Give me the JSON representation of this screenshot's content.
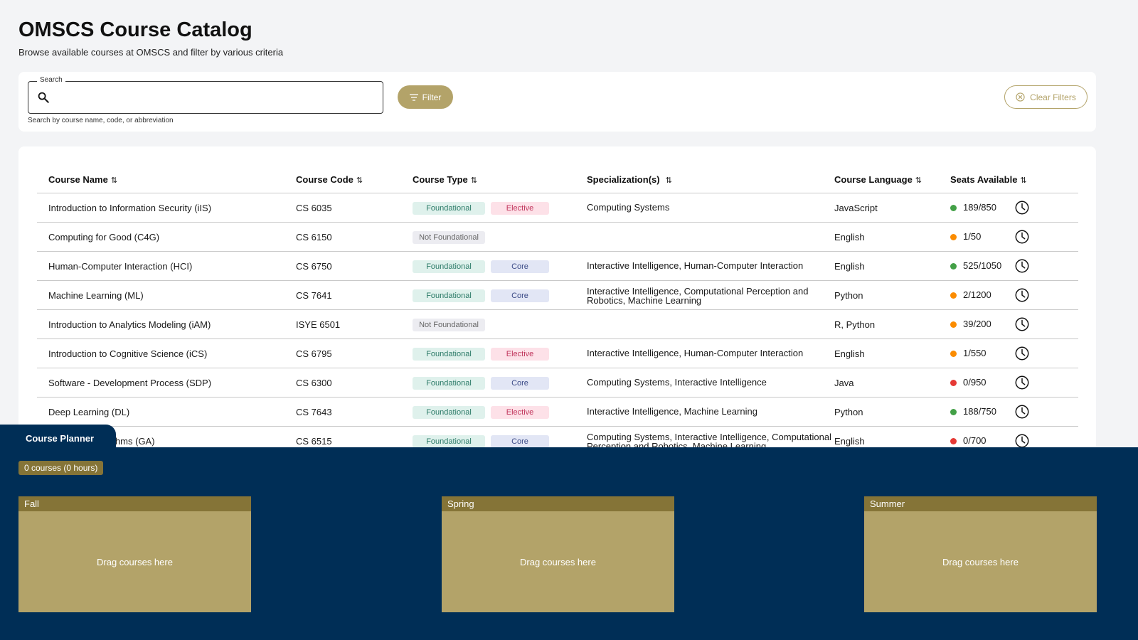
{
  "header": {
    "title": "OMSCS Course Catalog",
    "subtitle": "Browse available courses at OMSCS and filter by various criteria"
  },
  "search": {
    "legend": "Search",
    "value": "",
    "helper": "Search by course name, code, or abbreviation"
  },
  "filters": {
    "filter_label": "Filter",
    "clear_label": "Clear Filters"
  },
  "table": {
    "columns": [
      "Course Name",
      "Course Code",
      "Course Type",
      "Specialization(s)",
      "Course Language",
      "Seats Available"
    ],
    "rows": [
      {
        "name": "Introduction to Information Security (iIS)",
        "code": "CS 6035",
        "type": "Foundational",
        "category": "Elective",
        "specializations": "Computing Systems",
        "language": "JavaScript",
        "seats": "189/850",
        "status": "green"
      },
      {
        "name": "Computing for Good (C4G)",
        "code": "CS 6150",
        "type": "Not Foundational",
        "category": "",
        "specializations": "",
        "language": "English",
        "seats": "1/50",
        "status": "orange"
      },
      {
        "name": "Human-Computer Interaction (HCI)",
        "code": "CS 6750",
        "type": "Foundational",
        "category": "Core",
        "specializations": "Interactive Intelligence, Human-Computer Interaction",
        "language": "English",
        "seats": "525/1050",
        "status": "green"
      },
      {
        "name": "Machine Learning (ML)",
        "code": "CS 7641",
        "type": "Foundational",
        "category": "Core",
        "specializations": "Interactive Intelligence, Computational Perception and Robotics, Machine Learning",
        "language": "Python",
        "seats": "2/1200",
        "status": "orange"
      },
      {
        "name": "Introduction to Analytics Modeling (iAM)",
        "code": "ISYE 6501",
        "type": "Not Foundational",
        "category": "",
        "specializations": "",
        "language": "R, Python",
        "seats": "39/200",
        "status": "orange"
      },
      {
        "name": "Introduction to Cognitive Science (iCS)",
        "code": "CS 6795",
        "type": "Foundational",
        "category": "Elective",
        "specializations": "Interactive Intelligence, Human-Computer Interaction",
        "language": "English",
        "seats": "1/550",
        "status": "orange"
      },
      {
        "name": "Software - Development Process (SDP)",
        "code": "CS 6300",
        "type": "Foundational",
        "category": "Core",
        "specializations": "Computing Systems, Interactive Intelligence",
        "language": "Java",
        "seats": "0/950",
        "status": "red"
      },
      {
        "name": "Deep Learning (DL)",
        "code": "CS 7643",
        "type": "Foundational",
        "category": "Elective",
        "specializations": "Interactive Intelligence, Machine Learning",
        "language": "Python",
        "seats": "188/750",
        "status": "green"
      },
      {
        "name": "Graduate Algorithms (GA)",
        "code": "CS 6515",
        "type": "Foundational",
        "category": "Core",
        "specializations": "Computing Systems, Interactive Intelligence, Computational Perception and Robotics, Machine Learning",
        "language": "English",
        "seats": "0/700",
        "status": "red"
      }
    ]
  },
  "planner": {
    "tab_label": "Course Planner",
    "count": "0 courses (0 hours)",
    "semesters": [
      {
        "name": "Fall",
        "placeholder": "Drag courses here"
      },
      {
        "name": "Spring",
        "placeholder": "Drag courses here"
      },
      {
        "name": "Summer",
        "placeholder": "Drag courses here"
      }
    ]
  },
  "colors": {
    "gold": "#b3a369",
    "dark_gold": "#857437",
    "navy": "#002e56",
    "green": "#43a047",
    "orange": "#fb8c00",
    "red": "#e53935"
  }
}
